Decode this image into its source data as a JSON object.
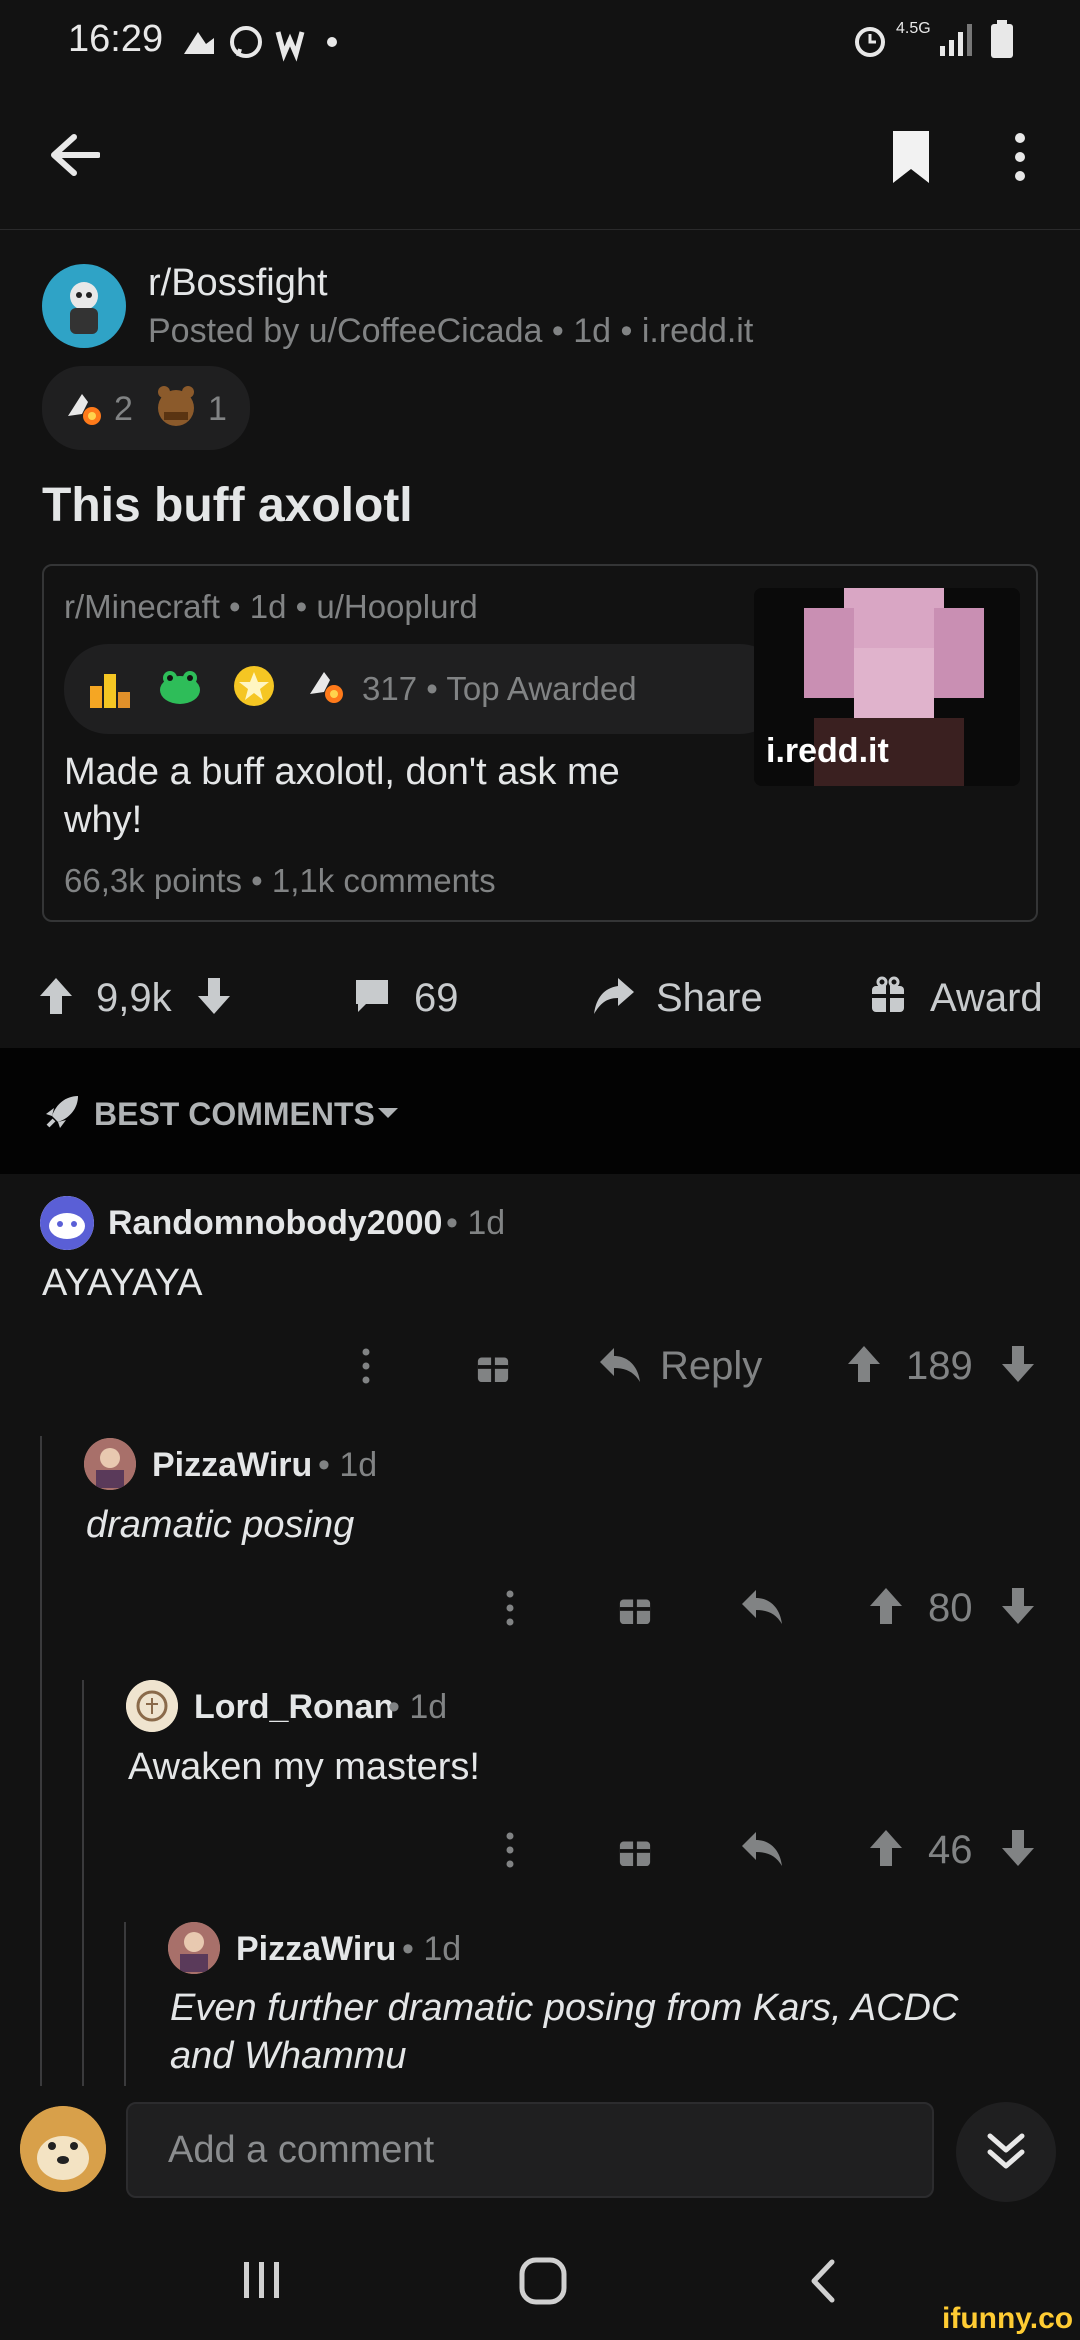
{
  "status": {
    "time": "16:29",
    "network": "4.5G"
  },
  "post": {
    "subreddit": "r/Bossfight",
    "meta": "Posted by u/CoffeeCicada • 1d • i.redd.it",
    "awards": [
      {
        "icon": "rocket-like-icon",
        "count": "2"
      },
      {
        "icon": "bear-award-icon",
        "count": "1"
      }
    ],
    "title": "This buff axolotl",
    "crosspost": {
      "meta": "r/Minecraft • 1d • u/Hooplurd",
      "awards_text": "317 • Top Awarded",
      "title": "Made a buff axolotl, don't ask me why!",
      "stats": "66,3k points • 1,1k comments",
      "thumb_label": "i.redd.it"
    },
    "votes": "9,9k",
    "comments": "69",
    "share_label": "Share",
    "award_label": "Award"
  },
  "sort": {
    "label": "BEST COMMENTS"
  },
  "comments": [
    {
      "author": "Randomnobody2000",
      "age": "• 1d",
      "body": "AYAYAYA",
      "reply_label": "Reply",
      "score": "189"
    },
    {
      "author": "PizzaWiru",
      "age": "• 1d",
      "body": "dramatic posing",
      "score": "80"
    },
    {
      "author": "Lord_Ronan",
      "age": "• 1d",
      "body": "Awaken my masters!",
      "score": "46"
    },
    {
      "author": "PizzaWiru",
      "age": "• 1d",
      "body": "Even further dramatic posing from Kars, ACDC and Whammu"
    }
  ],
  "composer": {
    "placeholder": "Add a comment"
  },
  "watermark": "ifunny.co",
  "colors": {
    "background": "#121212",
    "text": "#d7dadc",
    "muted": "#818384",
    "sort_bar": "#030303"
  }
}
